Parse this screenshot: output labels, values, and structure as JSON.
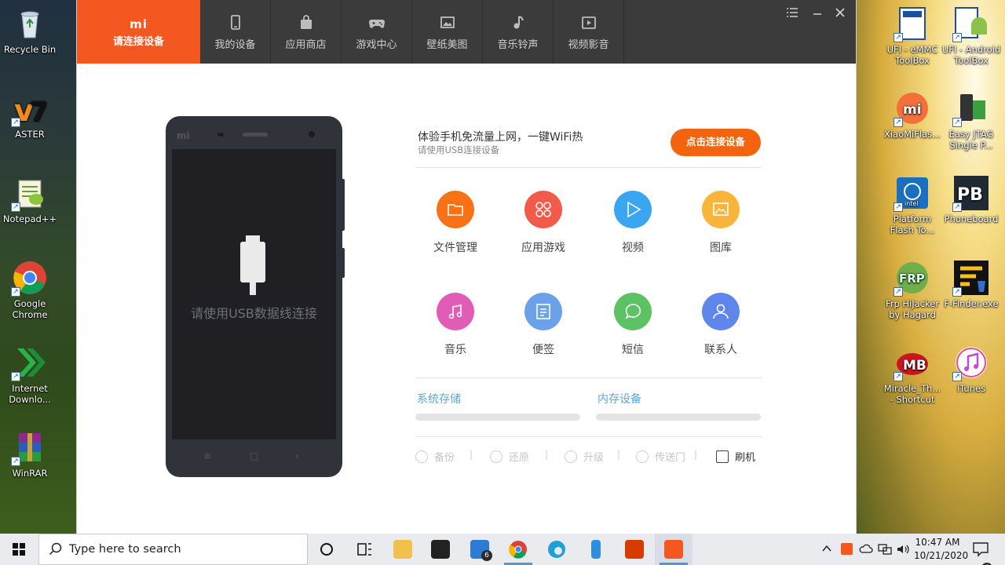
{
  "desktop": {
    "left_icons": [
      {
        "label": "Recycle Bin",
        "icon": "recycle-bin-icon"
      },
      {
        "label": "ASTER",
        "icon": "aster-icon"
      },
      {
        "label": "Notepad++",
        "icon": "notepad-plus-plus-icon"
      },
      {
        "label": "Google Chrome",
        "icon": "chrome-icon"
      },
      {
        "label": "Internet Downlo...",
        "icon": "internet-download-manager-icon"
      },
      {
        "label": "WinRAR",
        "icon": "winrar-icon"
      }
    ],
    "right_icons": [
      {
        "label": "UFI - eMMC ToolBox",
        "icon": "ufi-emmc-toolbox-icon"
      },
      {
        "label": "UFI - Android ToolBox",
        "icon": "ufi-android-toolbox-icon"
      },
      {
        "label": "XiaoMiFlas...",
        "icon": "xiaomi-flash-icon"
      },
      {
        "label": "Easy JTAG Single P...",
        "icon": "easy-jtag-icon"
      },
      {
        "label": "Platform Flash To...",
        "icon": "platform-flash-tool-icon"
      },
      {
        "label": "Phoneboard",
        "icon": "phoneboard-icon"
      },
      {
        "label": "Frp HiJacker by Hagard",
        "icon": "frp-hijacker-icon"
      },
      {
        "label": "F-Finder.exe",
        "icon": "f-finder-icon"
      },
      {
        "label": "Miracle_Th... - Shortcut",
        "icon": "miracle-thunder-icon"
      },
      {
        "label": "iTunes",
        "icon": "itunes-icon"
      }
    ]
  },
  "app": {
    "brand_logo": "mi",
    "active_tab": {
      "label": "请连接设备"
    },
    "tabs": [
      {
        "label": "我的设备",
        "icon": "phone-icon"
      },
      {
        "label": "应用商店",
        "icon": "shopping-bag-icon"
      },
      {
        "label": "游戏中心",
        "icon": "gamepad-icon"
      },
      {
        "label": "壁纸美图",
        "icon": "wallpaper-icon"
      },
      {
        "label": "音乐铃声",
        "icon": "music-note-icon"
      },
      {
        "label": "视频影音",
        "icon": "video-icon"
      }
    ],
    "phone": {
      "brand": "mi",
      "hint": "请使用USB数据线连接",
      "nav_icons": [
        "menu-icon",
        "home-icon",
        "back-icon"
      ]
    },
    "info": {
      "title": "体验手机免流量上网，一键WiFi热",
      "subtitle": "请使用USB连接设备",
      "connect_button": "点击连接设备"
    },
    "features": [
      {
        "label": "文件管理",
        "icon": "folder-icon",
        "color": "#f97316"
      },
      {
        "label": "应用游戏",
        "icon": "apps-grid-icon",
        "color": "#f25a4a"
      },
      {
        "label": "视频",
        "icon": "play-icon",
        "color": "#3aa6f2"
      },
      {
        "label": "图库",
        "icon": "image-icon",
        "color": "#f9b53a"
      },
      {
        "label": "音乐",
        "icon": "music-icon",
        "color": "#e05cb7"
      },
      {
        "label": "便签",
        "icon": "note-icon",
        "color": "#6aa1e8"
      },
      {
        "label": "短信",
        "icon": "message-icon",
        "color": "#5cc264"
      },
      {
        "label": "联系人",
        "icon": "contact-icon",
        "color": "#5f86ea"
      }
    ],
    "storage": {
      "system_label": "系统存储",
      "memory_label": "内存设备"
    },
    "actions": [
      {
        "label": "备份",
        "icon": "backup-icon",
        "enabled": false
      },
      {
        "label": "还原",
        "icon": "restore-icon",
        "enabled": false
      },
      {
        "label": "升级",
        "icon": "upgrade-icon",
        "enabled": false
      },
      {
        "label": "传送门",
        "icon": "portal-icon",
        "enabled": false
      },
      {
        "label": "刷机",
        "icon": "flash-icon",
        "enabled": true
      }
    ]
  },
  "taskbar": {
    "search_placeholder": "Type here to search",
    "mail_badge": "6",
    "notification_badge": "6",
    "clock_time": "10:47 AM",
    "clock_date": "10/21/2020"
  }
}
